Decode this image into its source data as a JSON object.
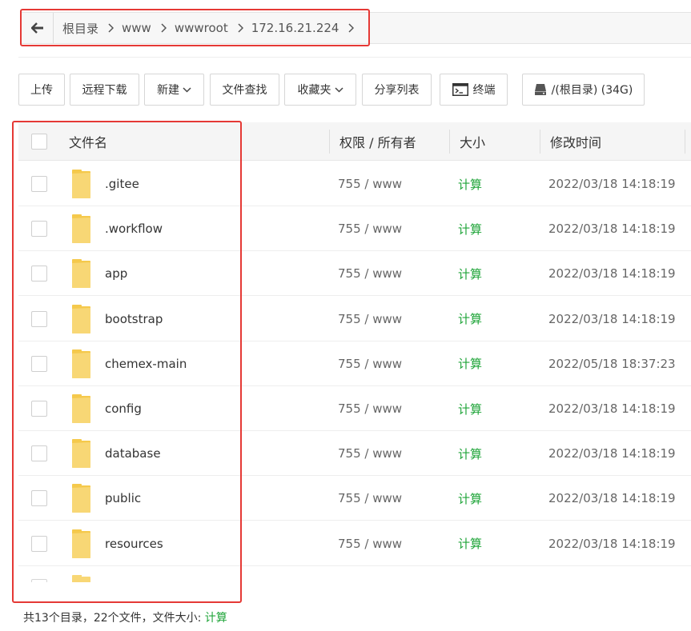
{
  "breadcrumb": {
    "items": [
      {
        "label": "根目录"
      },
      {
        "label": "www"
      },
      {
        "label": "wwwroot"
      },
      {
        "label": "172.16.21.224"
      }
    ]
  },
  "toolbar": {
    "upload": "上传",
    "remote_download": "远程下载",
    "new": "新建",
    "file_search": "文件查找",
    "favorites": "收藏夹",
    "share_list": "分享列表",
    "terminal": "终端",
    "disk": "/(根目录) (34G)"
  },
  "table": {
    "headers": {
      "name": "文件名",
      "perm": "权限 / 所有者",
      "size": "大小",
      "mtime": "修改时间"
    },
    "rows": [
      {
        "name": ".gitee",
        "perm": "755 / www",
        "size": "计算",
        "mtime": "2022/03/18 14:18:19"
      },
      {
        "name": ".workflow",
        "perm": "755 / www",
        "size": "计算",
        "mtime": "2022/03/18 14:18:19"
      },
      {
        "name": "app",
        "perm": "755 / www",
        "size": "计算",
        "mtime": "2022/03/18 14:18:19"
      },
      {
        "name": "bootstrap",
        "perm": "755 / www",
        "size": "计算",
        "mtime": "2022/03/18 14:18:19"
      },
      {
        "name": "chemex-main",
        "perm": "755 / www",
        "size": "计算",
        "mtime": "2022/05/18 18:37:23"
      },
      {
        "name": "config",
        "perm": "755 / www",
        "size": "计算",
        "mtime": "2022/03/18 14:18:19"
      },
      {
        "name": "database",
        "perm": "755 / www",
        "size": "计算",
        "mtime": "2022/03/18 14:18:19"
      },
      {
        "name": "public",
        "perm": "755 / www",
        "size": "计算",
        "mtime": "2022/03/18 14:18:19"
      },
      {
        "name": "resources",
        "perm": "755 / www",
        "size": "计算",
        "mtime": "2022/03/18 14:18:19"
      }
    ]
  },
  "footer": {
    "summary": "共13个目录，22个文件，文件大小: ",
    "calc": "计算"
  },
  "colors": {
    "accent_green": "#20a53a",
    "highlight_red": "#e53935",
    "folder_yellow": "#f8d775"
  }
}
